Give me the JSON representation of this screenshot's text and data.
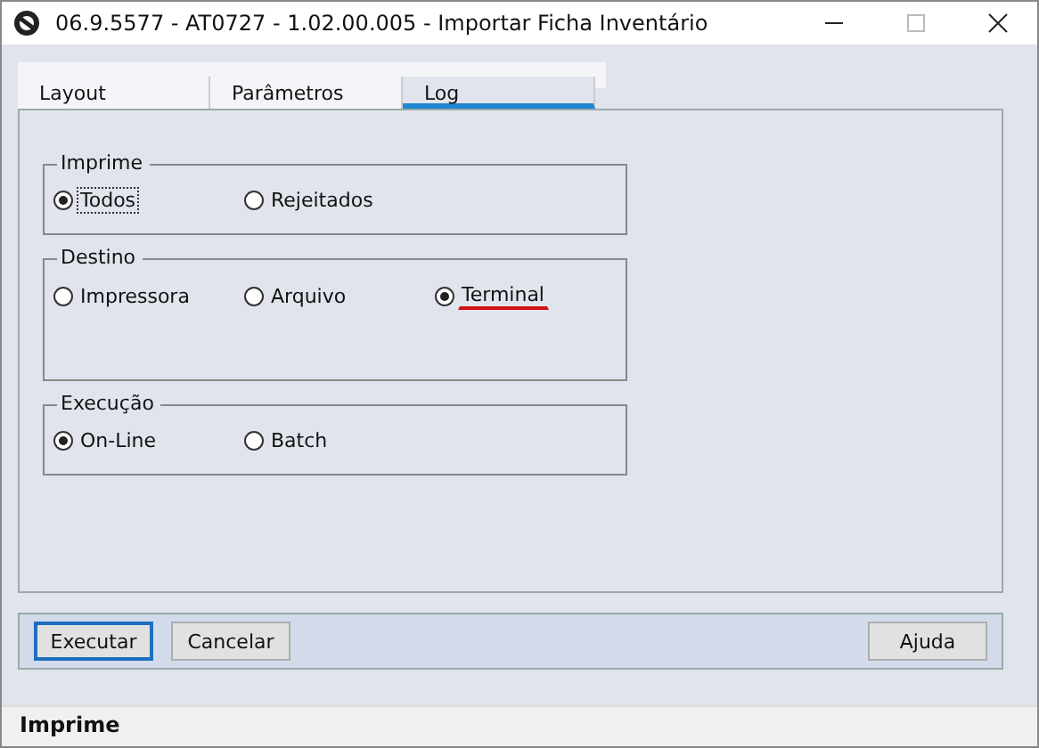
{
  "window": {
    "title": "06.9.5577 - AT0727 - 1.02.00.005 - Importar Ficha Inventário"
  },
  "tabs": [
    {
      "label": "Layout",
      "selected": false
    },
    {
      "label": "Parâmetros",
      "selected": false
    },
    {
      "label": "Log",
      "selected": true
    }
  ],
  "groups": [
    {
      "title": "Imprime",
      "tall": false,
      "options": [
        {
          "label": "Todos",
          "selected": true,
          "focused": true,
          "underlined": false
        },
        {
          "label": "Rejeitados",
          "selected": false,
          "focused": false,
          "underlined": false
        }
      ]
    },
    {
      "title": "Destino",
      "tall": true,
      "options": [
        {
          "label": "Impressora",
          "selected": false,
          "focused": false,
          "underlined": false
        },
        {
          "label": "Arquivo",
          "selected": false,
          "focused": false,
          "underlined": false
        },
        {
          "label": "Terminal",
          "selected": true,
          "focused": false,
          "underlined": true
        }
      ]
    },
    {
      "title": "Execução",
      "tall": false,
      "options": [
        {
          "label": "On-Line",
          "selected": true,
          "focused": false,
          "underlined": false
        },
        {
          "label": "Batch",
          "selected": false,
          "focused": false,
          "underlined": false
        }
      ]
    }
  ],
  "buttons": [
    {
      "label": "Executar",
      "default": true
    },
    {
      "label": "Cancelar",
      "default": false
    },
    {
      "label": "Ajuda",
      "default": false
    }
  ],
  "status_bar": "Imprime"
}
